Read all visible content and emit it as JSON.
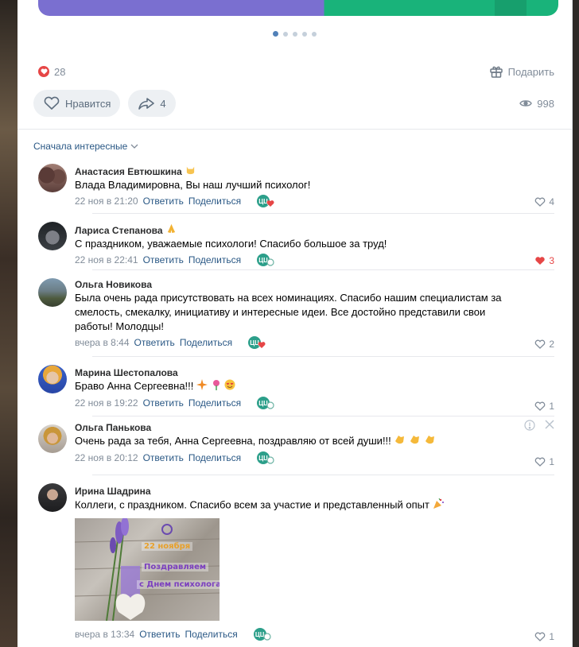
{
  "post": {
    "likes_count": "28",
    "gift_label": "Подарить",
    "like_button_label": "Нравится",
    "share_count": "4",
    "views_count": "998"
  },
  "carousel": {
    "total": 5,
    "active": 0
  },
  "sort": {
    "label": "Сначала интересные"
  },
  "actions": {
    "reply": "Ответить",
    "share": "Поделиться"
  },
  "comments": [
    {
      "author": "Анастасия Евтюшкина",
      "text": "Влада Владимировна, Вы наш лучший психолог!",
      "time": "22 ноя в 21:20",
      "likes": "4"
    },
    {
      "author": "Лариса Степанова",
      "text": "С праздником, уважаемые психологи! Спасибо большое за труд!",
      "time": "22 ноя в 22:41",
      "likes": "3"
    },
    {
      "author": "Ольга Новикова",
      "text_lines": [
        "Была очень рада присутствовать на всех номинациях. Спасибо нашим специалистам за",
        "смелость, смекалку, инициативу и интересные идеи. Все достойно представили свои",
        "работы! Молодцы!"
      ],
      "time": "вчера в 8:44",
      "likes": "2"
    },
    {
      "author": "Марина Шестопалова",
      "text": "Браво Анна Сергеевна!!!",
      "time": "22 ноя в 19:22",
      "likes": "1"
    },
    {
      "author": "Ольга Панькова",
      "text": "Очень рада за тебя, Анна Сергеевна, поздравляю от всей души!!!",
      "time": "22 ноя в 20:12",
      "likes": "1"
    },
    {
      "author": "Ирина Шадрина",
      "text": "Коллеги, с праздником. Спасибо всем за участие и представленный опыт",
      "time": "вчера в 13:34",
      "likes": "1",
      "attachment": {
        "lines": [
          "22 ноября",
          "Поздравляем",
          "с Днем психолога!"
        ]
      }
    }
  ],
  "reaction_badge": "ЦЦ",
  "colors": {
    "link": "#2a5885",
    "accent": "#5181b8",
    "like_red": "#e64646",
    "muted": "#818c99"
  }
}
